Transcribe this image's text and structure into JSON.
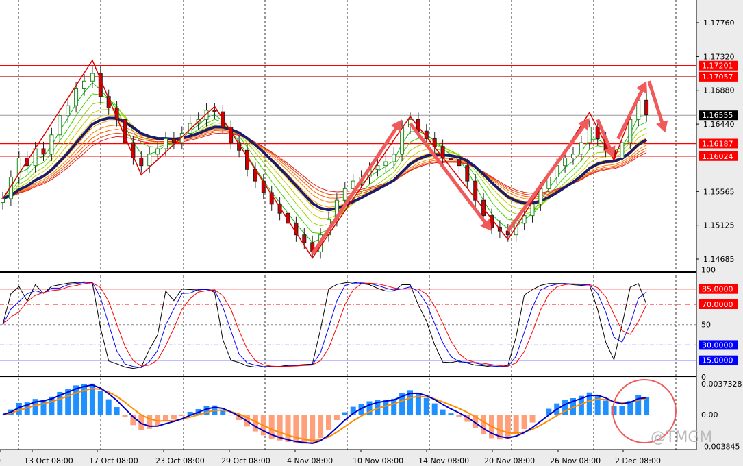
{
  "chart_data": {
    "type": "candlestick",
    "title": "",
    "price_axis": {
      "ticks": [
        "1.17760",
        "1.17320",
        "1.16880",
        "1.16440",
        "1.15565",
        "1.15125",
        "1.14685"
      ],
      "ylim": [
        1.1445,
        1.18
      ]
    },
    "price_tags": [
      {
        "label": "1.17201",
        "price": 1.17201,
        "color": "#ff0000"
      },
      {
        "label": "1.17057",
        "price": 1.17057,
        "color": "#ff0000"
      },
      {
        "label": "1.16555",
        "price": 1.16555,
        "color": "#000000"
      },
      {
        "label": "1.16187",
        "price": 1.16187,
        "color": "#ff0000"
      },
      {
        "label": "1.16024",
        "price": 1.16024,
        "color": "#ff0000"
      }
    ],
    "closes": [
      1.1547,
      1.1575,
      1.16,
      1.159,
      1.1612,
      1.1605,
      1.163,
      1.1655,
      1.1668,
      1.169,
      1.17,
      1.171,
      1.168,
      1.1665,
      1.165,
      1.162,
      1.16,
      1.159,
      1.1605,
      1.1612,
      1.1625,
      1.162,
      1.1632,
      1.1645,
      1.165,
      1.1662,
      1.166,
      1.164,
      1.162,
      1.161,
      1.1585,
      1.157,
      1.1555,
      1.154,
      1.1528,
      1.1515,
      1.15,
      1.149,
      1.1478,
      1.15,
      1.152,
      1.1545,
      1.156,
      1.157,
      1.1575,
      1.1585,
      1.159,
      1.1595,
      1.1605,
      1.164,
      1.165,
      1.1635,
      1.1625,
      1.1615,
      1.16,
      1.1598,
      1.159,
      1.157,
      1.1545,
      1.1525,
      1.151,
      1.1505,
      1.15,
      1.1515,
      1.1525,
      1.154,
      1.156,
      1.1575,
      1.159,
      1.16,
      1.1605,
      1.162,
      1.164,
      1.1625,
      1.161,
      1.16,
      1.162,
      1.165,
      1.1675,
      1.1656
    ],
    "zigzag": [
      [
        0,
        1.1547
      ],
      [
        11,
        1.1727
      ],
      [
        17,
        1.1578
      ],
      [
        26,
        1.1667
      ],
      [
        38,
        1.147
      ],
      [
        50,
        1.1654
      ],
      [
        62,
        1.1494
      ],
      [
        72,
        1.1659
      ],
      [
        75,
        1.1597
      ],
      [
        78,
        1.1681
      ]
    ],
    "arrows": [
      [
        [
          38,
          1.1475
        ],
        [
          49,
          1.165
        ]
      ],
      [
        [
          50,
          1.1645
        ],
        [
          60,
          1.1505
        ]
      ],
      [
        [
          62,
          1.1505
        ],
        [
          72,
          1.1652
        ]
      ],
      [
        [
          73,
          1.165
        ],
        [
          75,
          1.16
        ]
      ],
      [
        [
          75.5,
          1.1625
        ],
        [
          79,
          1.17
        ]
      ],
      [
        [
          79.3,
          1.17
        ],
        [
          81.3,
          1.1633
        ]
      ]
    ],
    "stochastic": {
      "ticks": [
        "100",
        "50",
        "0"
      ],
      "levels": [
        {
          "label": "85.0000",
          "value": 85,
          "color": "#ff0000"
        },
        {
          "label": "70.0000",
          "value": 70,
          "color": "#ff0000"
        },
        {
          "label": "30.0000",
          "value": 30,
          "color": "#0000ff"
        },
        {
          "label": "15.0000",
          "value": 15,
          "color": "#0000ff"
        }
      ]
    },
    "macd": {
      "ticks": [
        "0.0037328",
        "0.00",
        "-0.003845"
      ],
      "max": 0.0037328,
      "min": -0.003845
    },
    "x_labels": [
      "0",
      "13 Oct 08:00",
      "17 Oct 08:00",
      "23 Oct 08:00",
      "29 Oct 08:00",
      "4 Nov 08:00",
      "10 Nov 08:00",
      "14 Nov 08:00",
      "20 Nov 08:00",
      "26 Nov 08:00",
      "2 Dec 08:00"
    ]
  },
  "watermark": "@TMGM"
}
